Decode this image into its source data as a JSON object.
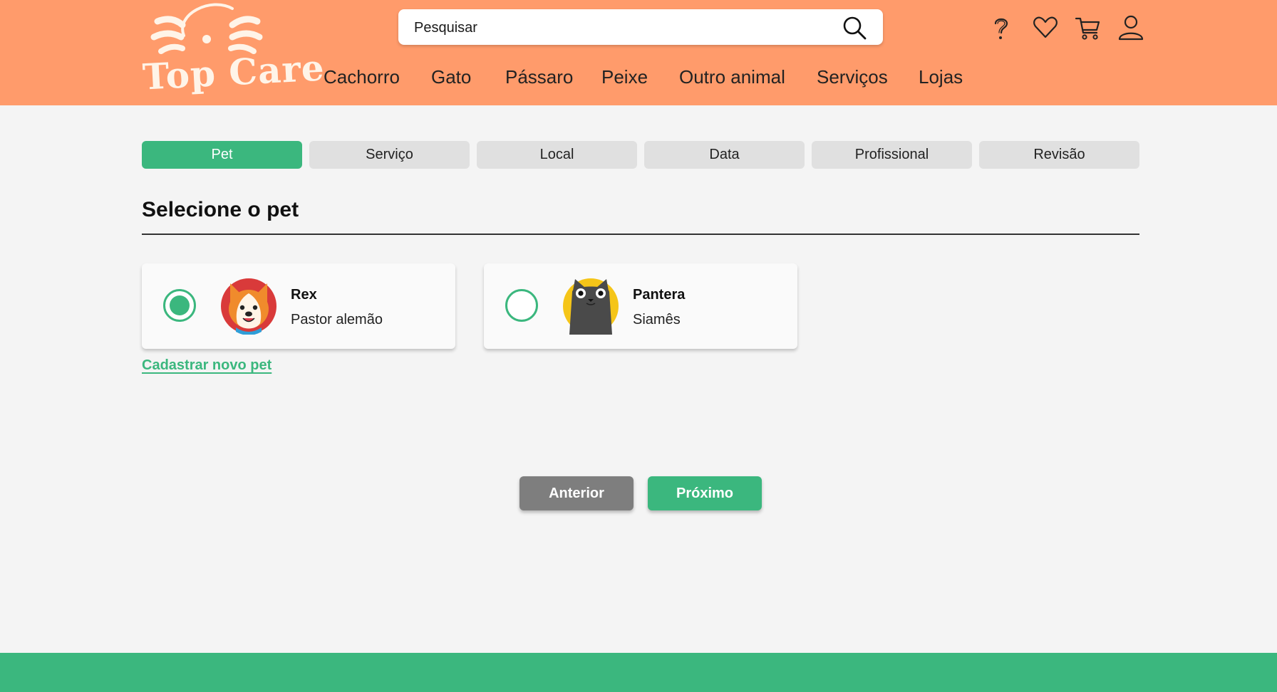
{
  "brand": {
    "logo_text": "Top Care"
  },
  "search": {
    "placeholder": "Pesquisar"
  },
  "header_icons": [
    "help-icon",
    "heart-icon",
    "cart-icon",
    "user-icon"
  ],
  "nav": [
    "Cachorro",
    "Gato",
    "Pássaro",
    "Peixe",
    "Outro animal",
    "Serviços",
    "Lojas"
  ],
  "steps": [
    {
      "label": "Pet",
      "active": true
    },
    {
      "label": "Serviço",
      "active": false
    },
    {
      "label": "Local",
      "active": false
    },
    {
      "label": "Data",
      "active": false
    },
    {
      "label": "Profissional",
      "active": false
    },
    {
      "label": "Revisão",
      "active": false
    }
  ],
  "section": {
    "title": "Selecione o pet"
  },
  "pets": [
    {
      "name": "Rex",
      "breed": "Pastor alemão",
      "selected": true,
      "avatar": "dog-avatar"
    },
    {
      "name": "Pantera",
      "breed": "Siamês",
      "selected": false,
      "avatar": "cat-avatar"
    }
  ],
  "new_pet_link": "Cadastrar novo pet",
  "buttons": {
    "previous": "Anterior",
    "next": "Próximo"
  },
  "colors": {
    "header": "#ff9b6b",
    "accent": "#3bb77e",
    "secondary_button": "#7e7e7e",
    "background": "#f4f4f4"
  }
}
